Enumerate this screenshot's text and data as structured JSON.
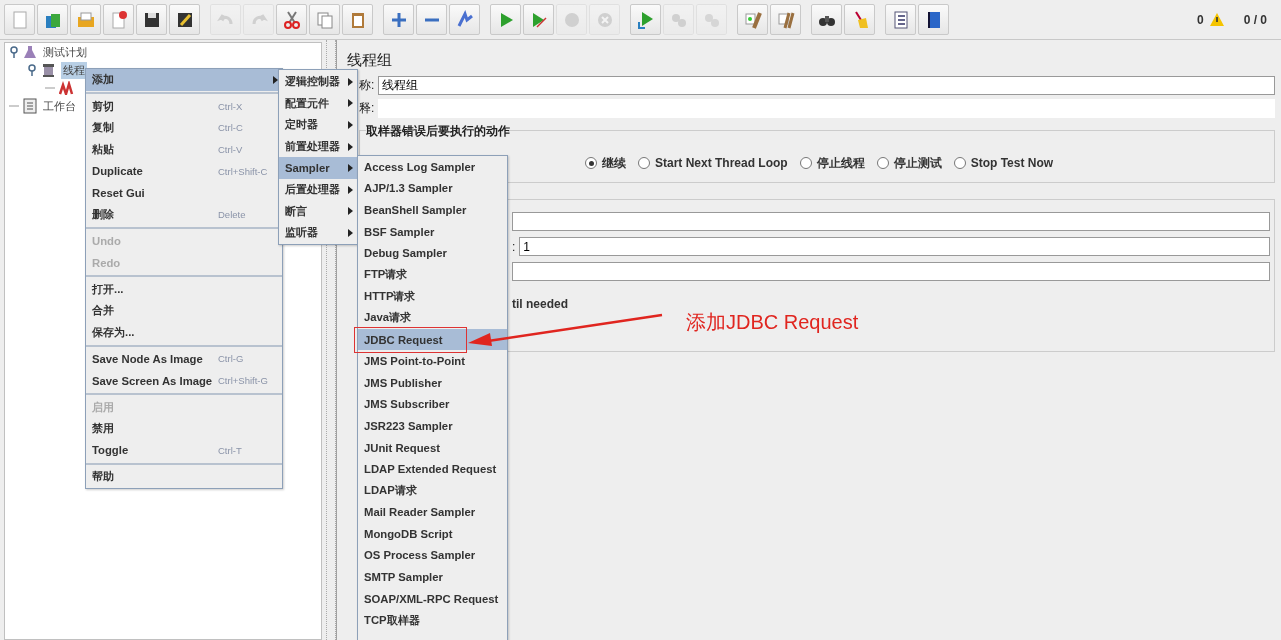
{
  "toolbar": {
    "groups": [
      [
        {
          "kind": "new",
          "disabled": false
        },
        {
          "kind": "templates",
          "disabled": false
        },
        {
          "kind": "open",
          "disabled": false
        },
        {
          "kind": "close",
          "disabled": false
        },
        {
          "kind": "save",
          "disabled": false
        },
        {
          "kind": "save-as",
          "disabled": false
        }
      ],
      [
        {
          "kind": "undo",
          "disabled": true
        },
        {
          "kind": "redo",
          "disabled": true
        },
        {
          "kind": "cut",
          "disabled": false
        },
        {
          "kind": "copy",
          "disabled": false
        },
        {
          "kind": "paste",
          "disabled": false
        }
      ],
      [
        {
          "kind": "expand",
          "disabled": false
        },
        {
          "kind": "collapse",
          "disabled": false
        },
        {
          "kind": "toggle",
          "disabled": false
        }
      ],
      [
        {
          "kind": "start",
          "disabled": false
        },
        {
          "kind": "start-no-pause",
          "disabled": false
        },
        {
          "kind": "stop",
          "disabled": true
        },
        {
          "kind": "shutdown",
          "disabled": true
        }
      ],
      [
        {
          "kind": "remote-start",
          "disabled": false
        },
        {
          "kind": "remote-start-all",
          "disabled": true
        },
        {
          "kind": "remote-stop",
          "disabled": true
        }
      ],
      [
        {
          "kind": "clear",
          "disabled": false
        },
        {
          "kind": "clear-all",
          "disabled": false
        }
      ],
      [
        {
          "kind": "search",
          "disabled": false
        },
        {
          "kind": "reset-search",
          "disabled": false
        }
      ],
      [
        {
          "kind": "functions",
          "disabled": false
        },
        {
          "kind": "help",
          "disabled": false
        }
      ]
    ],
    "warnings": "0",
    "threads": "0 / 0"
  },
  "tree": [
    {
      "label": "测试计划",
      "kind": "plan",
      "selected": false,
      "children": [
        {
          "label": "线程",
          "kind": "thread-group",
          "selected": true,
          "children": [
            {
              "kind": "sampler",
              "selected": false
            }
          ]
        }
      ]
    },
    {
      "label": "工作台",
      "kind": "workbench",
      "selected": false
    }
  ],
  "panel": {
    "title": "线程组",
    "name_label": "称:",
    "name_value": "线程组",
    "comment_label": "释:",
    "error_group": {
      "legend": "取样器错误后要执行的动作",
      "options": [
        {
          "label": "继续",
          "selected": true
        },
        {
          "label": "Start Next Thread Loop",
          "selected": false
        },
        {
          "label": "停止线程",
          "selected": false
        },
        {
          "label": "停止测试",
          "selected": false
        },
        {
          "label": "Stop Test Now",
          "selected": false
        }
      ]
    },
    "thread_props": {
      "count_label": ":",
      "count_value": "1",
      "delay_text": "til needed"
    }
  },
  "context_menu": {
    "groups": [
      [
        {
          "label": "添加",
          "disabled": false,
          "selected": true,
          "submenu": true
        }
      ],
      [
        {
          "label": "剪切",
          "shortcut": "Ctrl-X",
          "disabled": false,
          "selected": false,
          "submenu": false
        },
        {
          "label": "复制",
          "shortcut": "Ctrl-C",
          "disabled": false,
          "selected": false,
          "submenu": false
        },
        {
          "label": "粘贴",
          "shortcut": "Ctrl-V",
          "disabled": false,
          "selected": false,
          "submenu": false
        },
        {
          "label": "Duplicate",
          "shortcut": "Ctrl+Shift-C",
          "disabled": false,
          "selected": false,
          "submenu": false
        },
        {
          "label": "Reset Gui",
          "disabled": false,
          "selected": false,
          "submenu": false
        },
        {
          "label": "删除",
          "shortcut": "Delete",
          "disabled": false,
          "selected": false,
          "submenu": false
        }
      ],
      [
        {
          "label": "Undo",
          "disabled": true,
          "selected": false,
          "submenu": false
        },
        {
          "label": "Redo",
          "disabled": true,
          "selected": false,
          "submenu": false
        }
      ],
      [
        {
          "label": "打开...",
          "disabled": false,
          "selected": false,
          "submenu": false
        },
        {
          "label": "合并",
          "disabled": false,
          "selected": false,
          "submenu": false
        },
        {
          "label": "保存为...",
          "disabled": false,
          "selected": false,
          "submenu": false
        }
      ],
      [
        {
          "label": "Save Node As Image",
          "shortcut": "Ctrl-G",
          "disabled": false,
          "selected": false,
          "submenu": false
        },
        {
          "label": "Save Screen As Image",
          "shortcut": "Ctrl+Shift-G",
          "disabled": false,
          "selected": false,
          "submenu": false
        }
      ],
      [
        {
          "label": "启用",
          "disabled": true,
          "selected": false,
          "submenu": false
        },
        {
          "label": "禁用",
          "disabled": false,
          "selected": false,
          "submenu": false
        },
        {
          "label": "Toggle",
          "shortcut": "Ctrl-T",
          "disabled": false,
          "selected": false,
          "submenu": false
        }
      ],
      [
        {
          "label": "帮助",
          "disabled": false,
          "selected": false,
          "submenu": false
        }
      ]
    ]
  },
  "add_menu": [
    {
      "label": "逻辑控制器",
      "selected": false
    },
    {
      "label": "配置元件",
      "selected": false
    },
    {
      "label": "定时器",
      "selected": false
    },
    {
      "label": "前置处理器",
      "selected": false
    },
    {
      "label": "Sampler",
      "selected": true
    },
    {
      "label": "后置处理器",
      "selected": false
    },
    {
      "label": "断言",
      "selected": false
    },
    {
      "label": "监听器",
      "selected": false
    }
  ],
  "sampler_menu": [
    {
      "label": "Access Log Sampler",
      "selected": false,
      "marked": false
    },
    {
      "label": "AJP/1.3 Sampler",
      "selected": false,
      "marked": false
    },
    {
      "label": "BeanShell Sampler",
      "selected": false,
      "marked": false
    },
    {
      "label": "BSF Sampler",
      "selected": false,
      "marked": false
    },
    {
      "label": "Debug Sampler",
      "selected": false,
      "marked": false
    },
    {
      "label": "FTP请求",
      "selected": false,
      "marked": false
    },
    {
      "label": "HTTP请求",
      "selected": false,
      "marked": false
    },
    {
      "label": "Java请求",
      "selected": false,
      "marked": false
    },
    {
      "label": "JDBC Request",
      "selected": true,
      "marked": true
    },
    {
      "label": "JMS Point-to-Point",
      "selected": false,
      "marked": false
    },
    {
      "label": "JMS Publisher",
      "selected": false,
      "marked": false
    },
    {
      "label": "JMS Subscriber",
      "selected": false,
      "marked": false
    },
    {
      "label": "JSR223 Sampler",
      "selected": false,
      "marked": false
    },
    {
      "label": "JUnit Request",
      "selected": false,
      "marked": false
    },
    {
      "label": "LDAP Extended Request",
      "selected": false,
      "marked": false
    },
    {
      "label": "LDAP请求",
      "selected": false,
      "marked": false
    },
    {
      "label": "Mail Reader Sampler",
      "selected": false,
      "marked": false
    },
    {
      "label": "MongoDB Script",
      "selected": false,
      "marked": false
    },
    {
      "label": "OS Process Sampler",
      "selected": false,
      "marked": false
    },
    {
      "label": "SMTP Sampler",
      "selected": false,
      "marked": false
    },
    {
      "label": "SOAP/XML-RPC Request",
      "selected": false,
      "marked": false
    },
    {
      "label": "TCP取样器",
      "selected": false,
      "marked": false
    }
  ],
  "annotation": {
    "text": "添加JDBC Request"
  }
}
